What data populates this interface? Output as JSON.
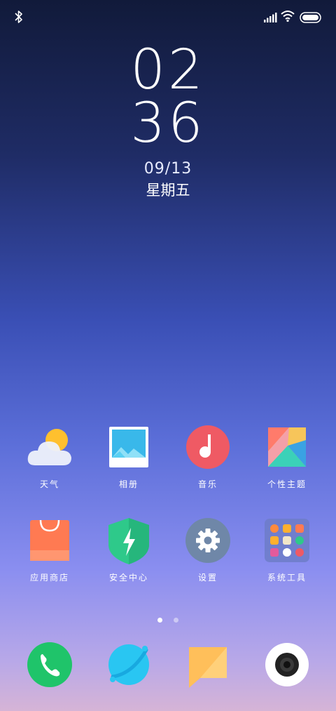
{
  "status_bar": {
    "bluetooth_icon": "bluetooth-icon",
    "signal_icon": "signal-icon",
    "wifi_icon": "wifi-icon",
    "battery_icon": "battery-icon"
  },
  "clock": {
    "hour": "02",
    "minute": "36",
    "date": "09/13",
    "weekday": "星期五"
  },
  "apps": [
    {
      "label": "天气",
      "icon": "weather-icon"
    },
    {
      "label": "相册",
      "icon": "gallery-icon"
    },
    {
      "label": "音乐",
      "icon": "music-icon"
    },
    {
      "label": "个性主题",
      "icon": "themes-icon"
    },
    {
      "label": "应用商店",
      "icon": "app-store-icon"
    },
    {
      "label": "安全中心",
      "icon": "security-icon"
    },
    {
      "label": "设置",
      "icon": "settings-icon"
    },
    {
      "label": "系统工具",
      "icon": "system-tools-folder-icon"
    }
  ],
  "page_indicator": {
    "pages": 2,
    "current": 1
  },
  "dock": [
    {
      "icon": "phone-icon"
    },
    {
      "icon": "browser-icon"
    },
    {
      "icon": "messages-icon"
    },
    {
      "icon": "camera-icon"
    }
  ],
  "colors": {
    "phone": "#1fc46a",
    "browser": "#29c6f2",
    "messages": "#ffbf5a",
    "music": "#ef5a64",
    "security": "#2ec98a",
    "settings": "#6f87a8"
  }
}
